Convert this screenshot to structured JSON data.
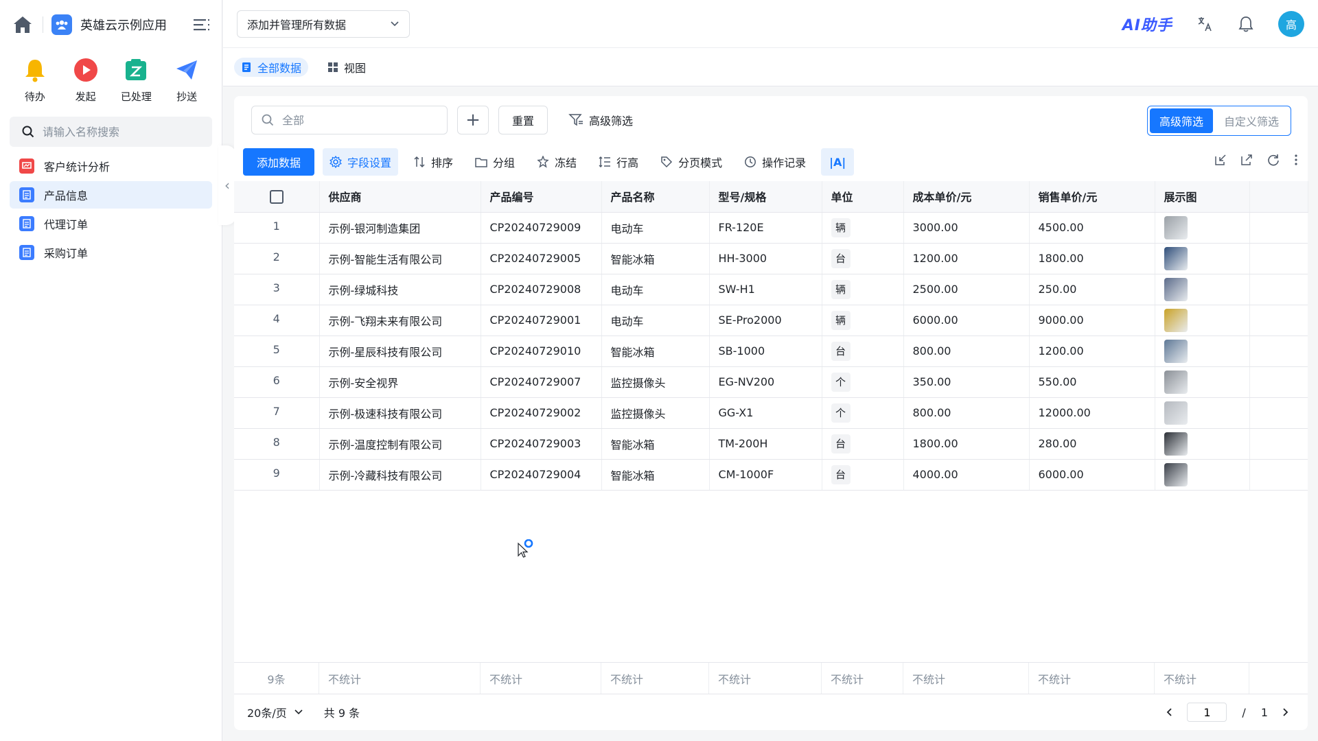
{
  "app": {
    "name": "英雄云示例应用"
  },
  "quick_actions": [
    {
      "label": "待办",
      "icon": "bell-icon",
      "color": "#f7b500"
    },
    {
      "label": "发起",
      "icon": "play-icon",
      "color": "#f04848"
    },
    {
      "label": "已处理",
      "icon": "done-icon",
      "color": "#18b28e"
    },
    {
      "label": "抄送",
      "icon": "send-icon",
      "color": "#3b7cff"
    }
  ],
  "sidebar_search": {
    "placeholder": "请输入名称搜索"
  },
  "nav": [
    {
      "label": "客户统计分析",
      "color": "#f04848",
      "active": false
    },
    {
      "label": "产品信息",
      "color": "#3b7cff",
      "active": true
    },
    {
      "label": "代理订单",
      "color": "#3b7cff",
      "active": false
    },
    {
      "label": "采购订单",
      "color": "#3b7cff",
      "active": false
    }
  ],
  "topbar": {
    "dataset": "添加并管理所有数据",
    "ai_label": "AI助手",
    "avatar": "高"
  },
  "view_tabs": [
    {
      "label": "全部数据",
      "active": true
    },
    {
      "label": "视图",
      "active": false
    }
  ],
  "filter": {
    "search_placeholder": "全部",
    "reset": "重置",
    "advanced": "高级筛选",
    "segments": [
      {
        "label": "高级筛选",
        "active": true
      },
      {
        "label": "自定义筛选",
        "active": false
      }
    ]
  },
  "toolbar": {
    "add": "添加数据",
    "tools": [
      "字段设置",
      "排序",
      "分组",
      "冻结",
      "行高",
      "分页模式",
      "操作记录"
    ],
    "text_tool": "|A|"
  },
  "table": {
    "columns": [
      "供应商",
      "产品编号",
      "产品名称",
      "型号/规格",
      "单位",
      "成本单价/元",
      "销售单价/元",
      "展示图"
    ],
    "rows": [
      {
        "idx": "1",
        "supplier": "示例-银河制造集团",
        "code": "CP20240729009",
        "name": "电动车",
        "model": "FR-120E",
        "unit": "辆",
        "cost": "3000.00",
        "price": "4500.00",
        "thumb": "#9aa0a6"
      },
      {
        "idx": "2",
        "supplier": "示例-智能生活有限公司",
        "code": "CP20240729005",
        "name": "智能冰箱",
        "model": "HH-3000",
        "unit": "台",
        "cost": "1200.00",
        "price": "1800.00",
        "thumb": "#2f4e7a"
      },
      {
        "idx": "3",
        "supplier": "示例-绿城科技",
        "code": "CP20240729008",
        "name": "电动车",
        "model": "SW-H1",
        "unit": "辆",
        "cost": "2500.00",
        "price": "250.00",
        "thumb": "#5b6b8a"
      },
      {
        "idx": "4",
        "supplier": "示例-飞翔未来有限公司",
        "code": "CP20240729001",
        "name": "电动车",
        "model": "SE-Pro2000",
        "unit": "辆",
        "cost": "6000.00",
        "price": "9000.00",
        "thumb": "#c9a227"
      },
      {
        "idx": "5",
        "supplier": "示例-星辰科技有限公司",
        "code": "CP20240729010",
        "name": "智能冰箱",
        "model": "SB-1000",
        "unit": "台",
        "cost": "800.00",
        "price": "1200.00",
        "thumb": "#5e7896"
      },
      {
        "idx": "6",
        "supplier": "示例-安全视界",
        "code": "CP20240729007",
        "name": "监控摄像头",
        "model": "EG-NV200",
        "unit": "个",
        "cost": "350.00",
        "price": "550.00",
        "thumb": "#8a8f96"
      },
      {
        "idx": "7",
        "supplier": "示例-极速科技有限公司",
        "code": "CP20240729002",
        "name": "监控摄像头",
        "model": "GG-X1",
        "unit": "个",
        "cost": "800.00",
        "price": "12000.00",
        "thumb": "#b5b9bf"
      },
      {
        "idx": "8",
        "supplier": "示例-温度控制有限公司",
        "code": "CP20240729003",
        "name": "智能冰箱",
        "model": "TM-200H",
        "unit": "台",
        "cost": "1800.00",
        "price": "280.00",
        "thumb": "#2b2f36"
      },
      {
        "idx": "9",
        "supplier": "示例-冷藏科技有限公司",
        "code": "CP20240729004",
        "name": "智能冰箱",
        "model": "CM-1000F",
        "unit": "台",
        "cost": "4000.00",
        "price": "6000.00",
        "thumb": "#3a3f48"
      }
    ],
    "footer_count": "9条",
    "footer_stat": "不统计"
  },
  "pager": {
    "page_size": "20条/页",
    "total": "共 9 条",
    "current": "1",
    "sep": "/",
    "pages": "1"
  }
}
